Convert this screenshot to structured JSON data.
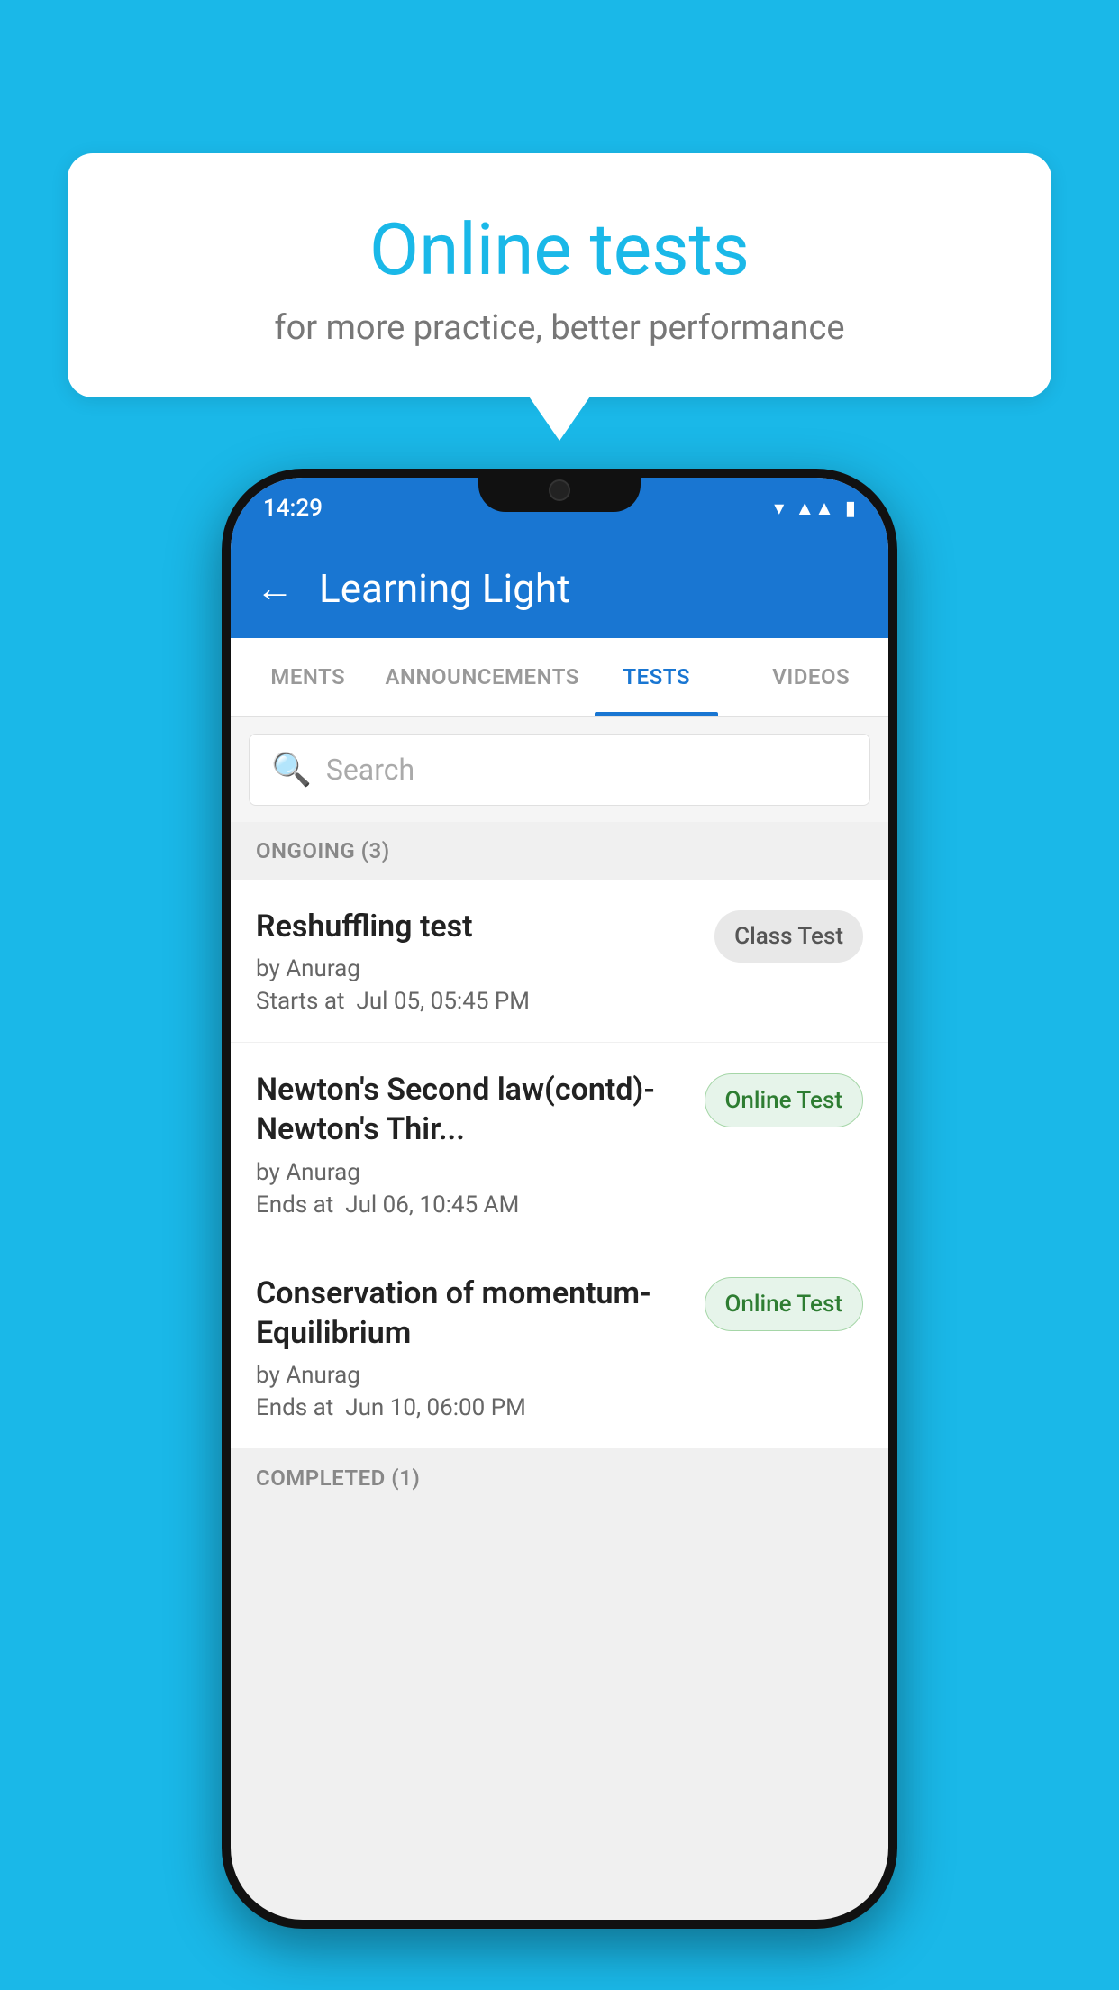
{
  "background": {
    "color": "#1ab8e8"
  },
  "hero": {
    "title": "Online tests",
    "subtitle": "for more practice, better performance"
  },
  "phone": {
    "status_bar": {
      "time": "14:29",
      "icons": [
        "wifi",
        "signal",
        "battery"
      ]
    },
    "app_bar": {
      "title": "Learning Light",
      "back_label": "←"
    },
    "tabs": [
      {
        "label": "MENTS",
        "active": false
      },
      {
        "label": "ANNOUNCEMENTS",
        "active": false
      },
      {
        "label": "TESTS",
        "active": true
      },
      {
        "label": "VIDEOS",
        "active": false
      }
    ],
    "search": {
      "placeholder": "Search"
    },
    "sections": [
      {
        "header": "ONGOING (3)",
        "items": [
          {
            "title": "Reshuffling test",
            "author": "by Anurag",
            "date_label": "Starts at",
            "date": "Jul 05, 05:45 PM",
            "badge": "Class Test",
            "badge_type": "class"
          },
          {
            "title": "Newton's Second law(contd)-Newton's Thir...",
            "author": "by Anurag",
            "date_label": "Ends at",
            "date": "Jul 06, 10:45 AM",
            "badge": "Online Test",
            "badge_type": "online"
          },
          {
            "title": "Conservation of momentum-Equilibrium",
            "author": "by Anurag",
            "date_label": "Ends at",
            "date": "Jun 10, 06:00 PM",
            "badge": "Online Test",
            "badge_type": "online"
          }
        ]
      },
      {
        "header": "COMPLETED (1)",
        "items": []
      }
    ]
  }
}
